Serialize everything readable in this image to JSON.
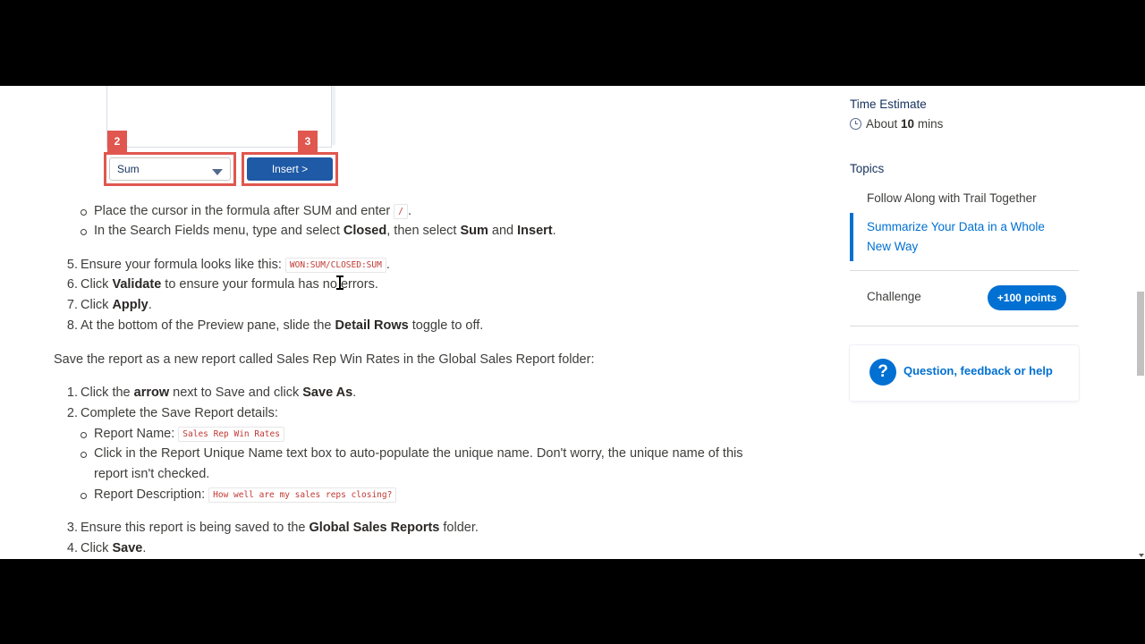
{
  "figure": {
    "badge_2": "2",
    "badge_3": "3",
    "select_value": "Sum",
    "insert_label": "Insert >"
  },
  "steps_a": {
    "bullet1_pre": "Place the cursor in the formula after SUM and enter",
    "bullet1_code": "/",
    "bullet1_post": ".",
    "bullet2_pre": "In the Search Fields menu, type and select",
    "bullet2_b1": "Closed",
    "bullet2_mid": ", then select",
    "bullet2_b2": "Sum",
    "bullet2_and": "and",
    "bullet2_b3": "Insert",
    "bullet2_post": ".",
    "n5": "5.",
    "s5_pre": "Ensure your formula looks like this:",
    "s5_code": "WON:SUM/CLOSED:SUM",
    "s5_post": ".",
    "n6": "6.",
    "s6_pre": "Click",
    "s6_b": "Validate",
    "s6_post": "to ensure your formula has no errors.",
    "n7": "7.",
    "s7_pre": "Click",
    "s7_b": "Apply",
    "s7_post": ".",
    "n8": "8.",
    "s8_pre": "At the bottom of the Preview pane, slide the",
    "s8_b": "Detail Rows",
    "s8_post": "toggle to off."
  },
  "save_intro": "Save the report as a new report called Sales Rep Win Rates in the Global Sales Report folder:",
  "steps_b": {
    "n1": "1.",
    "s1_pre": "Click the",
    "s1_b1": "arrow",
    "s1_mid": "next to Save and click",
    "s1_b2": "Save As",
    "s1_post": ".",
    "n2": "2.",
    "s2": "Complete the Save Report details:",
    "sub1_pre": "Report Name:",
    "sub1_code": "Sales Rep Win Rates",
    "sub2_line1": "Click in the Report Unique Name text box to auto-populate the unique name. Don't worry, the unique name of this",
    "sub2_line2": "report isn't checked.",
    "sub3_pre": "Report Description:",
    "sub3_code": "How well are my sales reps closing?",
    "n3": "3.",
    "s3_pre": "Ensure this report is being saved to the",
    "s3_b": "Global Sales Reports",
    "s3_post": "folder.",
    "n4": "4.",
    "s4_pre": "Click",
    "s4_b": "Save",
    "s4_post": "."
  },
  "sidebar": {
    "time_heading": "Time Estimate",
    "time_pre": "About",
    "time_value": "10",
    "time_unit": "mins",
    "topics_heading": "Topics",
    "topic_1": "Follow Along with Trail Together",
    "topic_2": "Summarize Your Data in a Whole New Way",
    "challenge_label": "Challenge",
    "points_label": "+100 points",
    "help_label": "Question, feedback or help"
  }
}
